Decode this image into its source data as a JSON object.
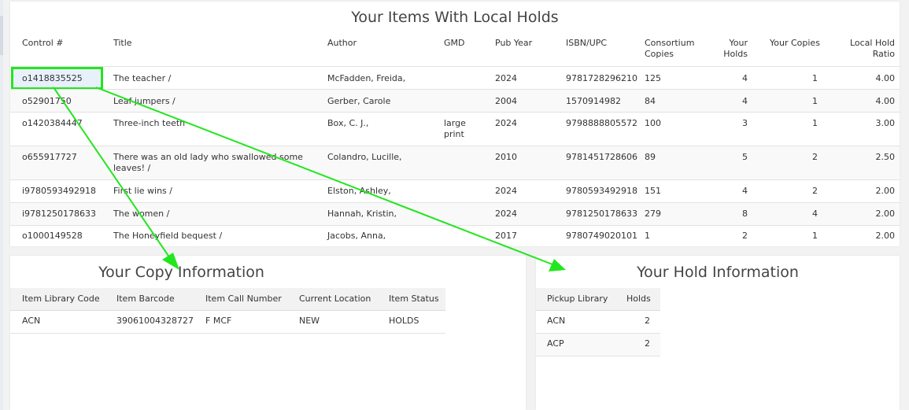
{
  "main": {
    "title": "Your Items With Local Holds",
    "headers": {
      "control": "Control #",
      "title": "Title",
      "author": "Author",
      "gmd": "GMD",
      "pubyear": "Pub Year",
      "isbn": "ISBN/UPC",
      "consortium_1": "Consortium",
      "consortium_2": "Copies",
      "holds_1": "Your",
      "holds_2": "Holds",
      "copies": "Your Copies",
      "ratio_1": "Local Hold",
      "ratio_2": "Ratio"
    },
    "rows": [
      {
        "control": "o1418835525",
        "title": "The teacher /",
        "author": "McFadden, Freida,",
        "gmd": "",
        "pubyear": "2024",
        "isbn": "9781728296210",
        "consortium": "125",
        "holds": "4",
        "copies": "1",
        "ratio": "4.00"
      },
      {
        "control": "o52901750",
        "title": "Leaf jumpers /",
        "author": "Gerber, Carole",
        "gmd": "",
        "pubyear": "2004",
        "isbn": "1570914982",
        "consortium": "84",
        "holds": "4",
        "copies": "1",
        "ratio": "4.00"
      },
      {
        "control": "o1420384447",
        "title": "Three-inch teeth",
        "author": "Box, C. J.,",
        "gmd": "large print",
        "pubyear": "2024",
        "isbn": "9798888805572",
        "consortium": "100",
        "holds": "3",
        "copies": "1",
        "ratio": "3.00"
      },
      {
        "control": "o655917727",
        "title": "There was an old lady who swallowed some leaves! /",
        "author": "Colandro, Lucille,",
        "gmd": "",
        "pubyear": "2010",
        "isbn": "9781451728606",
        "consortium": "89",
        "holds": "5",
        "copies": "2",
        "ratio": "2.50"
      },
      {
        "control": "i9780593492918",
        "title": "First lie wins /",
        "author": "Elston, Ashley,",
        "gmd": "",
        "pubyear": "2024",
        "isbn": "9780593492918",
        "consortium": "151",
        "holds": "4",
        "copies": "2",
        "ratio": "2.00"
      },
      {
        "control": "i9781250178633",
        "title": "The women /",
        "author": "Hannah, Kristin,",
        "gmd": "",
        "pubyear": "2024",
        "isbn": "9781250178633",
        "consortium": "279",
        "holds": "8",
        "copies": "4",
        "ratio": "2.00"
      },
      {
        "control": "o1000149528",
        "title": "The Honeyfield bequest /",
        "author": "Jacobs, Anna,",
        "gmd": "",
        "pubyear": "2017",
        "isbn": "9780749020101",
        "consortium": "1",
        "holds": "2",
        "copies": "1",
        "ratio": "2.00"
      }
    ]
  },
  "copy": {
    "title": "Your Copy Information",
    "headers": {
      "code": "Item Library Code",
      "barcode": "Item Barcode",
      "callnum": "Item Call Number",
      "location": "Current Location",
      "status": "Item Status"
    },
    "rows": [
      {
        "code": "ACN",
        "barcode": "39061004328727",
        "callnum": "F MCF",
        "location": "NEW",
        "status": "HOLDS"
      }
    ]
  },
  "holds": {
    "title": "Your Hold Information",
    "headers": {
      "library": "Pickup Library",
      "holds": "Holds"
    },
    "rows": [
      {
        "library": "ACN",
        "holds": "2"
      },
      {
        "library": "ACP",
        "holds": "2"
      }
    ]
  },
  "annotation": {
    "color": "#22e61f"
  }
}
